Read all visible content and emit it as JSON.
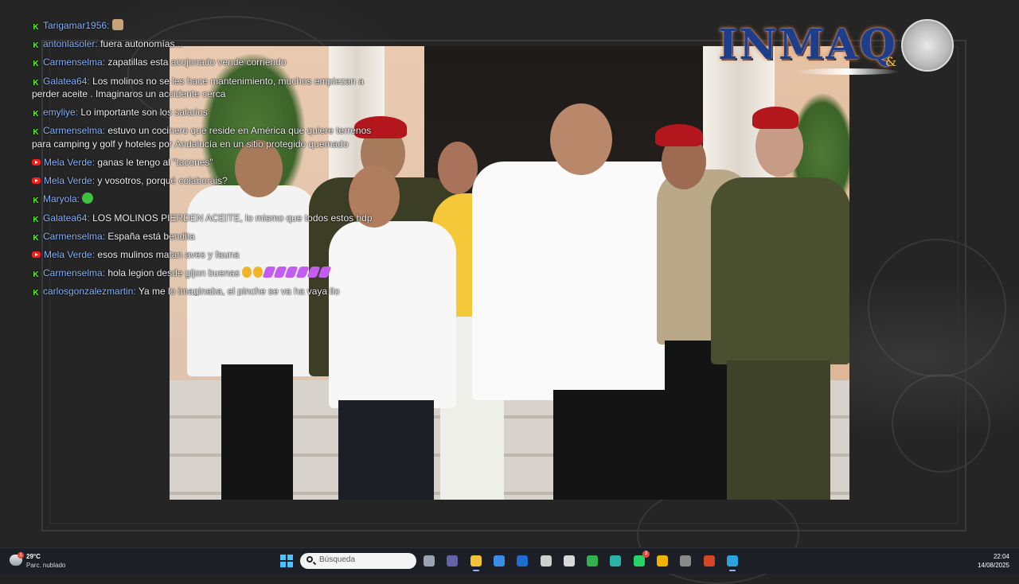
{
  "chat": {
    "messages": [
      {
        "platform": "kick",
        "user": "Tarigamar1956:",
        "text": "",
        "emoji": "cat"
      },
      {
        "platform": "kick",
        "user": "antonlasoler:",
        "text": "fuera autonomías...",
        "emoji": ""
      },
      {
        "platform": "kick",
        "user": "Carmenselma:",
        "text": "zapatillas esta acojonado vende corriendo",
        "emoji": ""
      },
      {
        "platform": "kick",
        "user": "Galatea64:",
        "text": "Los molinos no se les hace mantenimiento, muchos empiezan a perder aceite . Imaginaros un accidente cerca",
        "emoji": ""
      },
      {
        "platform": "kick",
        "user": "emyliye:",
        "text": "Lo importante son los salarios",
        "emoji": ""
      },
      {
        "platform": "kick",
        "user": "Carmenselma:",
        "text": "estuvo un cocinero que reside en América que quiere terrenos para camping y golf y hoteles por Andalucía en un sitio protegido quemado",
        "emoji": ""
      },
      {
        "platform": "youtube",
        "user": "Mela Verde:",
        "text": "ganas le tengo al \"tacones\"",
        "emoji": ""
      },
      {
        "platform": "youtube",
        "user": "Mela Verde:",
        "text": "y vosotros, porqué colaboráis?",
        "emoji": ""
      },
      {
        "platform": "kick",
        "user": "Maryola:",
        "text": "",
        "emoji": "green"
      },
      {
        "platform": "kick",
        "user": "Galatea64:",
        "text": "LOS MOLINOS PIERDEN ACEITE, lo mismo que todos estos hdp",
        "emoji": ""
      },
      {
        "platform": "kick",
        "user": "Carmenselma:",
        "text": "España está bendita",
        "emoji": ""
      },
      {
        "platform": "youtube",
        "user": "Mela Verde:",
        "text": "esos mulinos matan aves y fauna",
        "emoji": ""
      },
      {
        "platform": "kick",
        "user": "Carmenselma:",
        "text": "hola legion desde gijon buenas",
        "emoji": "row"
      },
      {
        "platform": "kick",
        "user": "carlosgonzalezmartin:",
        "text": "Ya me lo imaginaba, el pinche se va ha vaya lio",
        "emoji": ""
      }
    ]
  },
  "logo": {
    "text": "INMAQ",
    "amp": "&"
  },
  "taskbar": {
    "weather": {
      "temp": "29°C",
      "desc": "Parc. nublado",
      "badge": "1"
    },
    "search_placeholder": "Búsqueda",
    "apps": [
      {
        "name": "task-view",
        "color": "#9aa4b2",
        "badge": "",
        "active": false
      },
      {
        "name": "teams",
        "color": "#6264a7",
        "badge": "",
        "active": false
      },
      {
        "name": "file-explorer",
        "color": "#f3c13a",
        "badge": "",
        "active": true
      },
      {
        "name": "store",
        "color": "#3a8ee6",
        "badge": "",
        "active": false
      },
      {
        "name": "outlook",
        "color": "#1c6fd1",
        "badge": "",
        "active": false
      },
      {
        "name": "obs-like",
        "color": "#cfcfcf",
        "badge": "",
        "active": false
      },
      {
        "name": "unity-like",
        "color": "#d8d8d8",
        "badge": "",
        "active": false
      },
      {
        "name": "camtasia",
        "color": "#2fb34a",
        "badge": "",
        "active": false
      },
      {
        "name": "edge",
        "color": "#2bb3a8",
        "badge": "",
        "active": false
      },
      {
        "name": "whatsapp",
        "color": "#25d366",
        "badge": "3",
        "active": false
      },
      {
        "name": "chrome",
        "color": "#f0b400",
        "badge": "",
        "active": false
      },
      {
        "name": "obs",
        "color": "#8a8a8a",
        "badge": "",
        "active": false
      },
      {
        "name": "powerpoint",
        "color": "#d24726",
        "badge": "",
        "active": false
      },
      {
        "name": "telegram",
        "color": "#2aa3e0",
        "badge": "",
        "active": true
      }
    ],
    "time": "22:04",
    "date": "14/08/2025"
  }
}
